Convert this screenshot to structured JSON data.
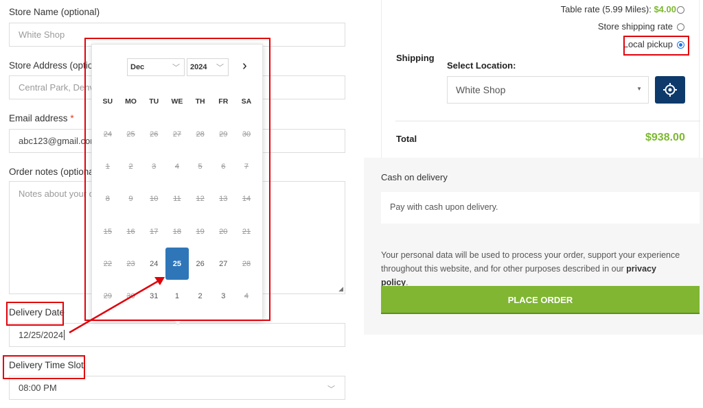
{
  "form": {
    "store_name_label": "Store Name (optional)",
    "store_name_value": "White Shop",
    "store_address_label": "Store Address (optional)",
    "store_address_value": "Central Park, Denver",
    "email_label": "Email address",
    "email_required": "*",
    "email_value": "abc123@gmail.com",
    "order_notes_label": "Order notes (optional)",
    "order_notes_placeholder": "Notes about your order",
    "delivery_date_label": "Delivery Date",
    "delivery_date_value": "12/25/2024",
    "delivery_time_label": "Delivery Time Slot",
    "delivery_time_value": "08:00 PM"
  },
  "calendar": {
    "month": "Dec",
    "year": "2024",
    "next_icon": "chevron-right-icon",
    "weekdays": [
      "SU",
      "MO",
      "TU",
      "WE",
      "TH",
      "FR",
      "SA"
    ],
    "days": [
      {
        "d": "24",
        "state": "disabled"
      },
      {
        "d": "25",
        "state": "disabled"
      },
      {
        "d": "26",
        "state": "disabled"
      },
      {
        "d": "27",
        "state": "disabled"
      },
      {
        "d": "28",
        "state": "disabled"
      },
      {
        "d": "29",
        "state": "disabled"
      },
      {
        "d": "30",
        "state": "disabled"
      },
      {
        "d": "1",
        "state": "disabled"
      },
      {
        "d": "2",
        "state": "disabled"
      },
      {
        "d": "3",
        "state": "disabled"
      },
      {
        "d": "4",
        "state": "disabled"
      },
      {
        "d": "5",
        "state": "disabled"
      },
      {
        "d": "6",
        "state": "disabled"
      },
      {
        "d": "7",
        "state": "disabled"
      },
      {
        "d": "8",
        "state": "disabled"
      },
      {
        "d": "9",
        "state": "disabled"
      },
      {
        "d": "10",
        "state": "disabled"
      },
      {
        "d": "11",
        "state": "disabled"
      },
      {
        "d": "12",
        "state": "disabled"
      },
      {
        "d": "13",
        "state": "disabled"
      },
      {
        "d": "14",
        "state": "disabled"
      },
      {
        "d": "15",
        "state": "disabled"
      },
      {
        "d": "16",
        "state": "disabled"
      },
      {
        "d": "17",
        "state": "disabled"
      },
      {
        "d": "18",
        "state": "disabled"
      },
      {
        "d": "19",
        "state": "disabled"
      },
      {
        "d": "20",
        "state": "disabled"
      },
      {
        "d": "21",
        "state": "disabled"
      },
      {
        "d": "22",
        "state": "disabled"
      },
      {
        "d": "23",
        "state": "disabled"
      },
      {
        "d": "24",
        "state": "enabled"
      },
      {
        "d": "25",
        "state": "selected"
      },
      {
        "d": "26",
        "state": "enabled"
      },
      {
        "d": "27",
        "state": "enabled"
      },
      {
        "d": "28",
        "state": "disabled"
      },
      {
        "d": "29",
        "state": "disabled"
      },
      {
        "d": "30",
        "state": "disabled"
      },
      {
        "d": "31",
        "state": "enabled"
      },
      {
        "d": "1",
        "state": "enabled"
      },
      {
        "d": "2",
        "state": "enabled"
      },
      {
        "d": "3",
        "state": "enabled"
      },
      {
        "d": "4",
        "state": "disabled"
      }
    ],
    "selected_color": "#2f76b8"
  },
  "shipping": {
    "rate1_label": "Table rate (5.99 Miles): ",
    "rate1_price": "$4.00",
    "rate2_label": "Store shipping rate",
    "rate3_label": "Local pickup",
    "selected_rate": "Local pickup",
    "shipping_label": "Shipping",
    "select_location_label": "Select Location:",
    "location_value": "White Shop",
    "locate_icon": "crosshair-icon"
  },
  "totals": {
    "total_label": "Total",
    "total_value": "$938.00",
    "price_color": "#7cb82f"
  },
  "payment": {
    "method_label": "Cash on delivery",
    "method_description": "Pay with cash upon delivery.",
    "privacy_text": "Your personal data will be used to process your order, support your experience throughout this website, and for other purposes described in our ",
    "privacy_link": "privacy policy",
    "privacy_end": ".",
    "place_order_label": "PLACE ORDER",
    "button_color": "#80b632"
  },
  "annotation_color": "#e0000a"
}
